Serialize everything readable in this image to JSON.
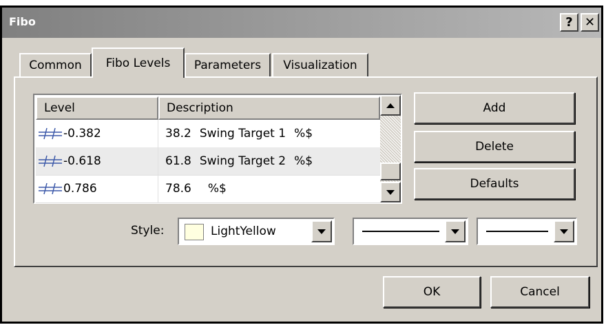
{
  "window": {
    "title": "Fibo",
    "help_label": "?",
    "close_label": "✕"
  },
  "tabs": [
    {
      "label": "Common",
      "active": false
    },
    {
      "label": "Fibo Levels",
      "active": true
    },
    {
      "label": "Parameters",
      "active": false
    },
    {
      "label": "Visualization",
      "active": false
    }
  ],
  "table": {
    "headers": {
      "level": "Level",
      "description": "Description"
    },
    "rows": [
      {
        "level": "-0.382",
        "desc_value": "38.2",
        "desc_label": "Swing Target 1",
        "desc_suffix": "%$"
      },
      {
        "level": "-0.618",
        "desc_value": "61.8",
        "desc_label": "Swing Target 2",
        "desc_suffix": "%$"
      },
      {
        "level": "0.786",
        "desc_value": "78.6",
        "desc_label": "",
        "desc_suffix": "%$"
      }
    ],
    "line_icon_color": "#3a57a8"
  },
  "buttons": {
    "add": "Add",
    "delete": "Delete",
    "defaults": "Defaults",
    "ok": "OK",
    "cancel": "Cancel"
  },
  "style": {
    "label": "Style:",
    "color_name": "LightYellow",
    "color_value": "#ffffe0"
  },
  "colors": {
    "face": "#d4d0c8",
    "title_gradient_start": "#808080",
    "title_gradient_end": "#b8b8b8"
  }
}
